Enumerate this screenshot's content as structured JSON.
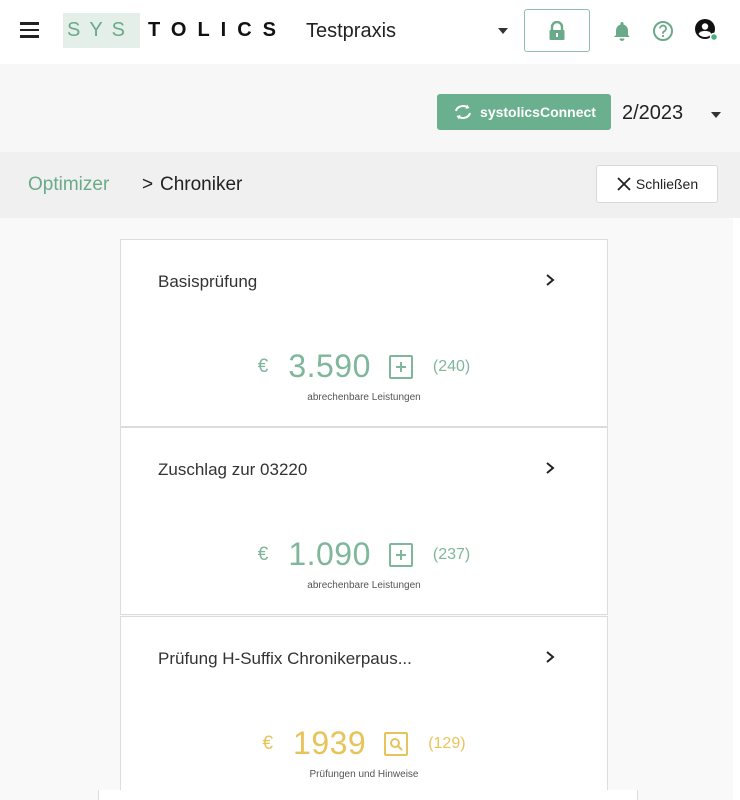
{
  "header": {
    "logo": {
      "part1": "SYS",
      "part2": "TOLICS"
    },
    "practice": "Testpraxis",
    "icons": [
      "menu-icon",
      "lock-icon",
      "bell-icon",
      "help-icon",
      "user-icon"
    ]
  },
  "subheader": {
    "connect_label": "systolicsConnect",
    "quarter": "2/2023"
  },
  "breadcrumb": {
    "root": "Optimizer",
    "separator": ">",
    "current": "Chroniker",
    "close_label": "Schließen"
  },
  "cards": [
    {
      "title": "Basisprüfung",
      "currency": "€",
      "amount": "3.590",
      "count": "(240)",
      "subtitle": "abrechenbare Leistungen",
      "action_icon": "plus-icon",
      "color": "#7fb79b"
    },
    {
      "title": "Zuschlag zur 03220",
      "currency": "€",
      "amount": "1.090",
      "count": "(237)",
      "subtitle": "abrechenbare Leistungen",
      "action_icon": "plus-icon",
      "color": "#7fb79b"
    },
    {
      "title": "Prüfung H-Suffix Chronikerpaus...",
      "currency": "€",
      "amount": "1939",
      "count": "(129)",
      "subtitle": "Prüfungen und Hinweise",
      "action_icon": "search-icon",
      "color": "#e8c35a"
    }
  ],
  "colors": {
    "accent": "#6bb08e",
    "warning": "#e8c35a"
  }
}
